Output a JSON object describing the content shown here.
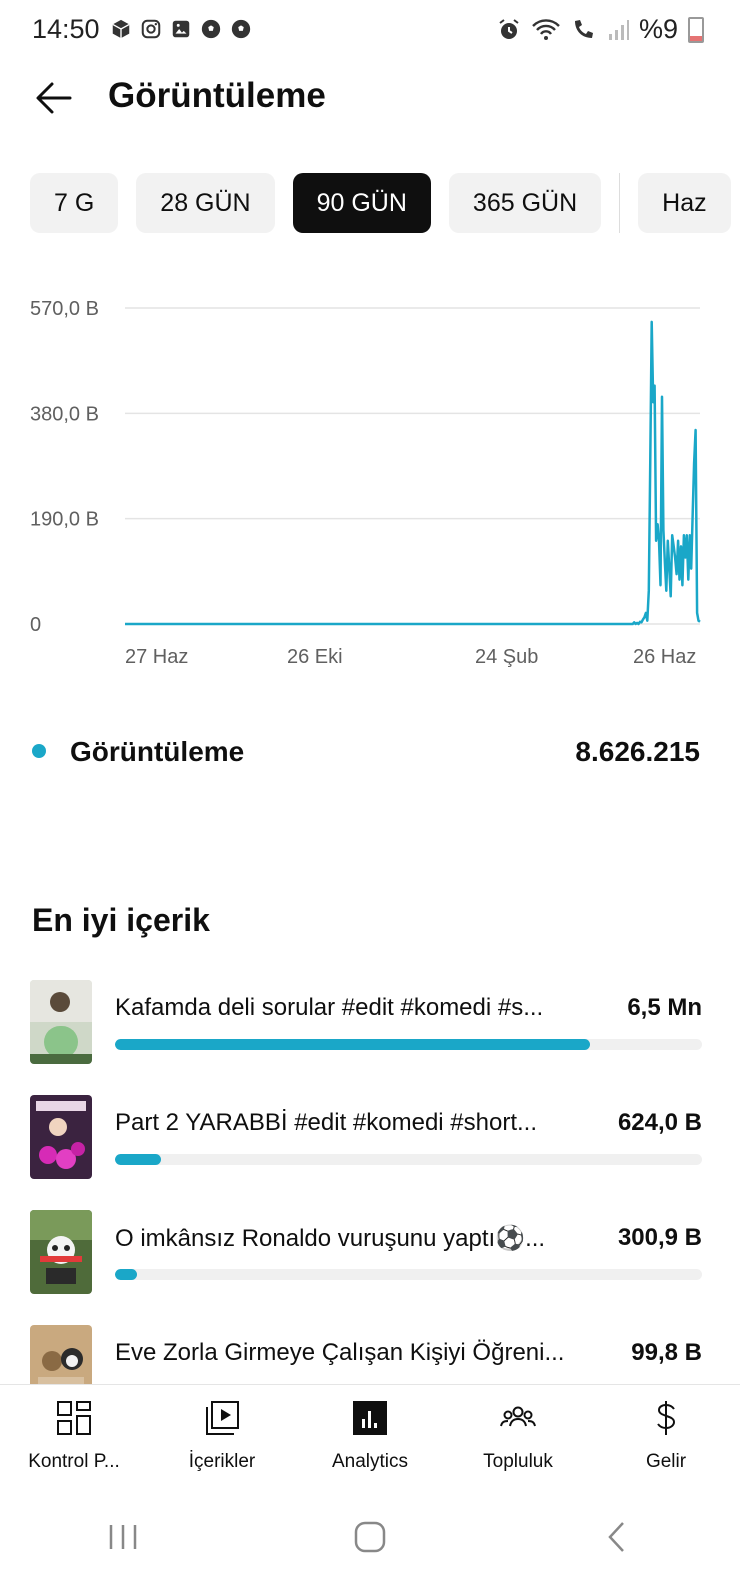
{
  "status": {
    "time": "14:50",
    "battery": "%9"
  },
  "header": {
    "title": "Görüntüleme"
  },
  "chips": [
    "7 G",
    "28 GÜN",
    "90 GÜN",
    "365 GÜN",
    "Haz"
  ],
  "chart_data": {
    "type": "line",
    "yticks": [
      "570,0 B",
      "380,0 B",
      "190,0 B",
      "0"
    ],
    "xticks": [
      "27 Haz",
      "26 Eki",
      "24 Şub",
      "26 Haz"
    ],
    "ylim": [
      0,
      570000
    ],
    "color": "#1aa7c8",
    "grid": true,
    "series": [
      {
        "values": [
          0,
          0,
          0,
          0,
          0,
          0,
          0,
          0,
          0,
          0,
          0,
          0,
          0,
          0,
          0,
          0,
          0,
          0,
          0,
          0,
          0,
          0,
          0,
          0,
          0,
          0,
          0,
          0,
          0,
          0,
          0,
          0,
          0,
          0,
          0,
          0,
          0,
          0,
          0,
          0,
          0,
          0,
          0,
          0,
          0,
          0,
          0,
          0,
          0,
          0,
          0,
          0,
          0,
          0,
          0,
          0,
          0,
          0,
          0,
          0,
          0,
          0,
          0,
          0,
          0,
          0,
          0,
          0,
          0,
          0,
          0,
          0,
          0,
          0,
          0,
          0,
          0,
          0,
          0,
          0,
          0,
          0,
          0,
          0,
          0,
          0,
          0,
          0,
          0,
          0,
          0,
          0,
          0,
          0,
          0,
          0,
          0,
          0,
          0,
          0,
          0,
          0,
          0,
          0,
          0,
          0,
          0,
          0,
          0,
          0,
          0,
          0,
          0,
          0,
          0,
          0,
          0,
          0,
          0,
          0,
          0,
          0,
          0,
          0,
          0,
          0,
          0,
          0,
          0,
          0,
          0,
          0,
          0,
          0,
          0,
          0,
          0,
          0,
          0,
          0,
          0,
          0,
          0,
          0,
          0,
          0,
          0,
          0,
          0,
          0,
          0,
          0,
          0,
          0,
          0,
          0,
          0,
          0,
          0,
          0,
          0,
          0,
          0,
          0,
          0,
          0,
          0,
          0,
          0,
          0,
          0,
          0,
          0,
          0,
          0,
          0,
          0,
          0,
          0,
          0,
          0,
          0,
          0,
          0,
          0,
          0,
          0,
          0,
          0,
          0,
          0,
          0,
          0,
          0,
          0,
          0,
          0,
          0,
          0,
          0,
          0,
          0,
          0,
          0,
          0,
          0,
          0,
          0,
          0,
          0,
          0,
          0,
          0,
          0,
          0,
          0,
          0,
          0,
          0,
          0,
          0,
          0,
          0,
          0,
          0,
          0,
          0,
          0,
          0,
          0,
          0,
          0,
          0,
          0,
          0,
          0,
          0,
          0,
          0,
          0,
          0,
          0,
          0,
          0,
          0,
          0,
          0,
          0,
          0,
          0,
          0,
          0,
          0,
          0,
          0,
          0,
          0,
          0,
          0,
          0,
          0,
          0,
          0,
          0,
          0,
          0,
          0,
          0,
          0,
          0,
          0,
          0,
          0,
          0,
          0,
          0,
          0,
          0,
          0,
          0,
          0,
          0,
          0,
          0,
          0,
          0,
          0,
          0,
          0,
          0,
          0,
          0,
          0,
          0,
          0,
          0,
          0,
          0,
          0,
          0,
          0,
          0,
          0,
          0,
          0,
          0,
          0,
          0,
          0,
          0,
          0,
          0,
          0,
          0,
          0,
          0,
          0,
          0,
          0,
          0,
          0,
          0,
          0,
          0,
          0,
          0,
          0,
          0,
          0,
          0,
          0,
          0,
          0,
          0,
          0,
          0,
          0,
          0,
          0,
          0,
          0,
          0,
          0,
          0,
          0,
          0,
          0,
          0,
          3000,
          0,
          2000,
          0,
          4000,
          3000,
          8000,
          12000,
          20000,
          6000,
          60000,
          300000,
          545000,
          400000,
          430000,
          150000,
          180000,
          150000,
          70000,
          410000,
          170000,
          110000,
          60000,
          150000,
          100000,
          50000,
          160000,
          140000,
          120000,
          90000,
          150000,
          80000,
          140000,
          70000,
          160000,
          120000,
          160000,
          80000,
          160000,
          100000,
          200000,
          290000,
          350000,
          20000,
          6000,
          4000
        ]
      }
    ]
  },
  "legend": {
    "label": "Görüntüleme",
    "value": "8.626.215"
  },
  "top_content": {
    "title": "En iyi içerik",
    "items": [
      {
        "title": "Kafamda deli sorular #edit #komedi #s...",
        "value": "6,5 Mn",
        "ratio": 0.81
      },
      {
        "title": "Part 2 YARABBİ  #edit #komedi #short...",
        "value": "624,0 B",
        "ratio": 0.078
      },
      {
        "title": "O imkânsız Ronaldo vuruşunu yaptı⚽...",
        "value": "300,9 B",
        "ratio": 0.037
      },
      {
        "title": "Eve Zorla Girmeye Çalışan Kişiyi Öğreni...",
        "value": "99,8 B",
        "ratio": 0.015
      }
    ]
  },
  "nav": {
    "dashboard": "Kontrol P...",
    "content": "İçerikler",
    "analytics": "Analytics",
    "community": "Topluluk",
    "earn": "Gelir"
  }
}
